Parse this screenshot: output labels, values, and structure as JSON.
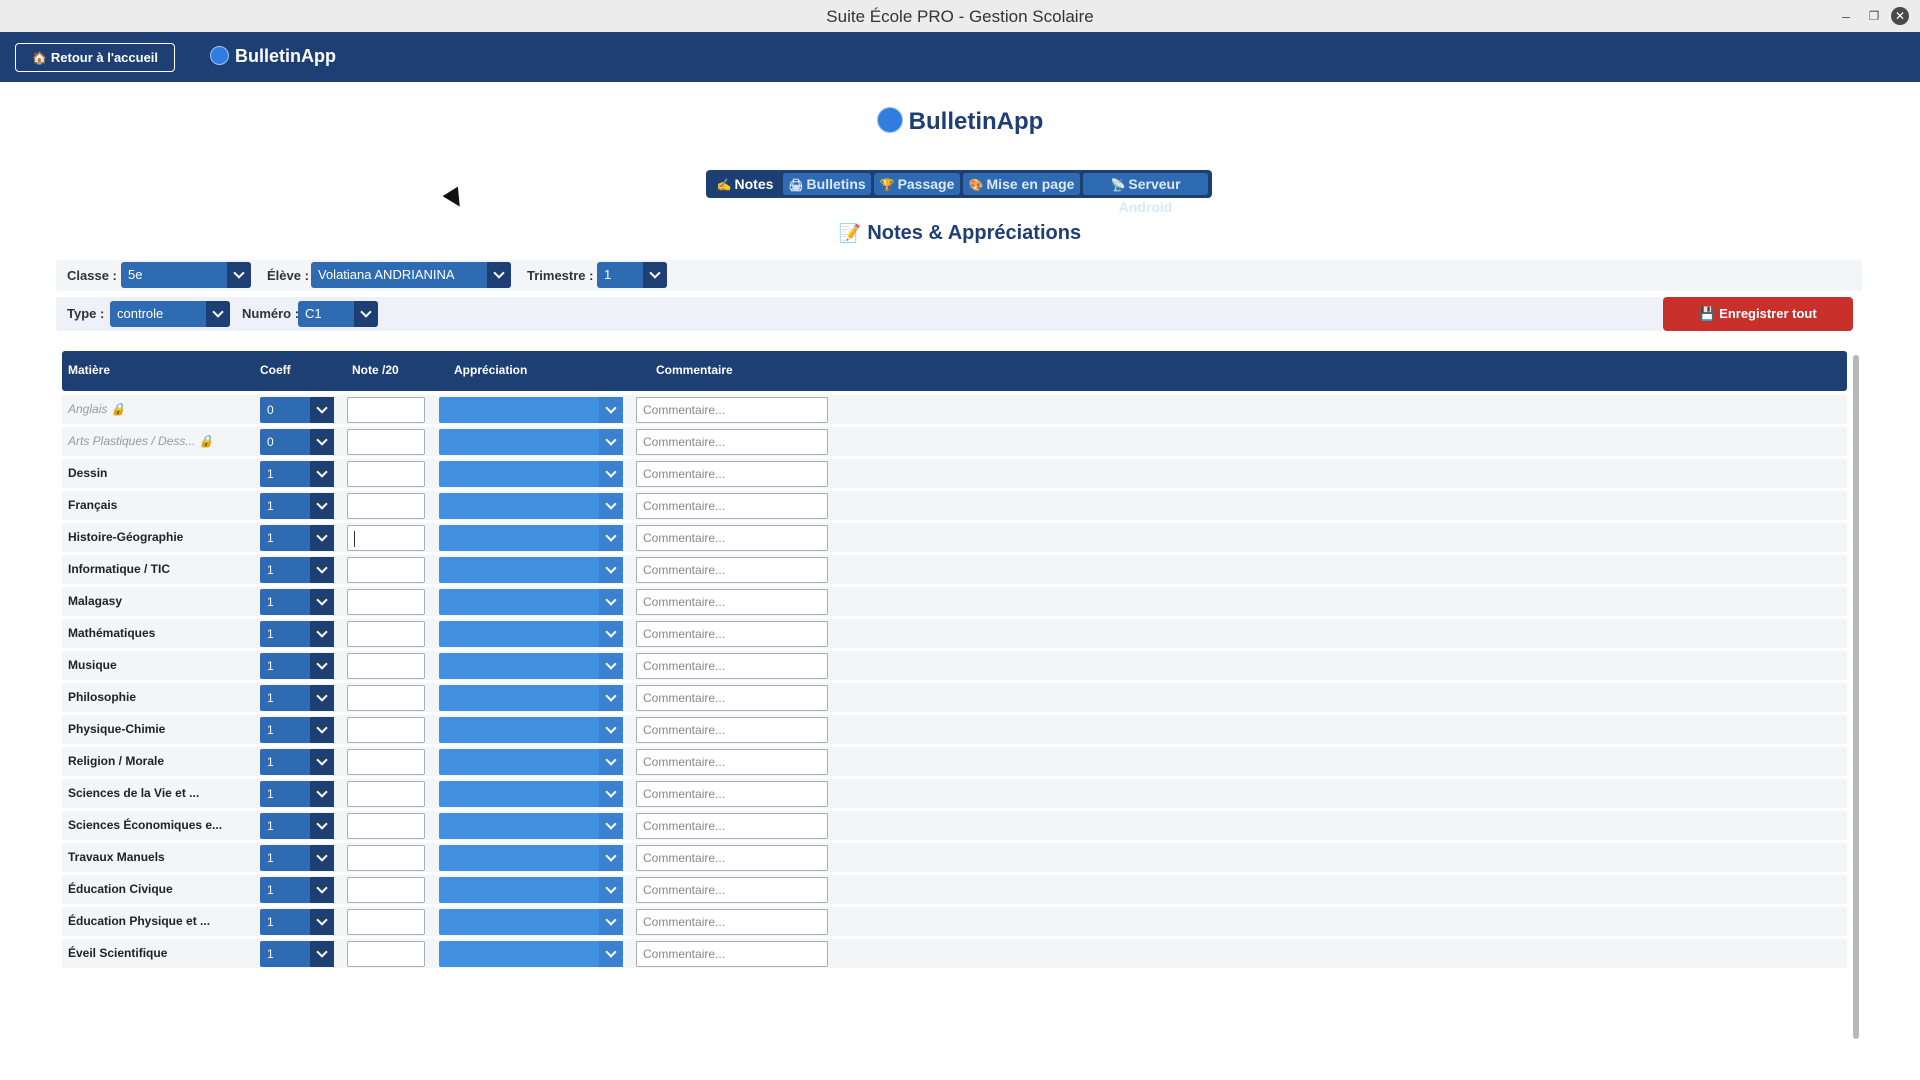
{
  "window": {
    "title": "Suite École PRO - Gestion Scolaire"
  },
  "header": {
    "home_label": "Retour à l'accueil",
    "app_name": "BulletinApp"
  },
  "main": {
    "title": "BulletinApp",
    "section_title": "Notes & Appréciations"
  },
  "tabs": [
    {
      "icon": "✍",
      "label": "Notes"
    },
    {
      "icon": "🖨",
      "label": "Bulletins"
    },
    {
      "icon": "🏆",
      "label": "Passage"
    },
    {
      "icon": "🎨",
      "label": "Mise en page"
    },
    {
      "icon": "📡",
      "label": "Serveur Android"
    }
  ],
  "filters": {
    "classe_label": "Classe :",
    "classe_value": "5e",
    "eleve_label": "Élève :",
    "eleve_value": "Volatiana ANDRIANINA",
    "trimestre_label": "Trimestre :",
    "trimestre_value": "1",
    "type_label": "Type :",
    "type_value": "controle",
    "numero_label": "Numéro :",
    "numero_value": "C1"
  },
  "save_button": "💾 Enregistrer tout",
  "table": {
    "columns": [
      "Matière",
      "Coeff",
      "Note /20",
      "Appréciation",
      "Commentaire"
    ],
    "comment_placeholder": "Commentaire...",
    "rows": [
      {
        "subject": "Anglais 🔒",
        "coeff": "0",
        "dim": true
      },
      {
        "subject": "Arts Plastiques / Dess... 🔒",
        "coeff": "0",
        "dim": true
      },
      {
        "subject": "Dessin",
        "coeff": "1"
      },
      {
        "subject": "Français",
        "coeff": "1"
      },
      {
        "subject": "Histoire-Géographie",
        "coeff": "1",
        "focus": true
      },
      {
        "subject": "Informatique / TIC",
        "coeff": "1"
      },
      {
        "subject": "Malagasy",
        "coeff": "1"
      },
      {
        "subject": "Mathématiques",
        "coeff": "1"
      },
      {
        "subject": "Musique",
        "coeff": "1"
      },
      {
        "subject": "Philosophie",
        "coeff": "1"
      },
      {
        "subject": "Physique-Chimie",
        "coeff": "1"
      },
      {
        "subject": "Religion / Morale",
        "coeff": "1"
      },
      {
        "subject": "Sciences de la Vie et ...",
        "coeff": "1"
      },
      {
        "subject": "Sciences Économiques e...",
        "coeff": "1"
      },
      {
        "subject": "Travaux Manuels",
        "coeff": "1"
      },
      {
        "subject": "Éducation Civique",
        "coeff": "1"
      },
      {
        "subject": "Éducation Physique et ...",
        "coeff": "1"
      },
      {
        "subject": "Éveil Scientifique",
        "coeff": "1"
      }
    ]
  }
}
